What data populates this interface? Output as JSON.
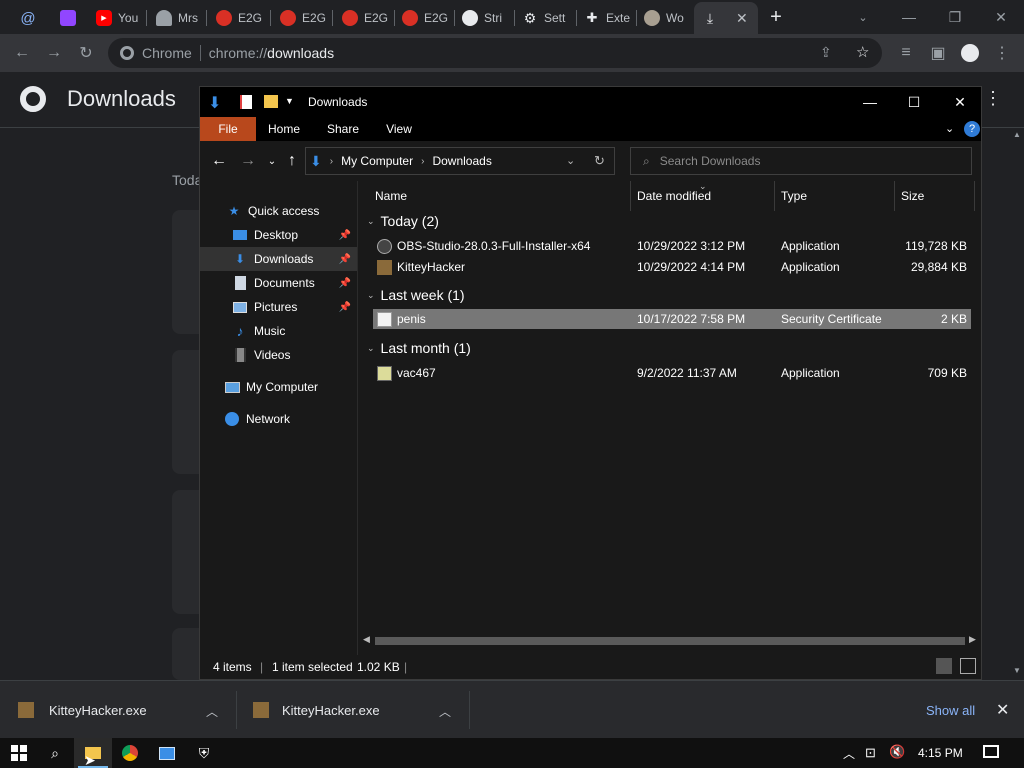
{
  "browser": {
    "tabs": [
      {
        "label": "",
        "icon": "at-sign-icon"
      },
      {
        "label": "",
        "icon": "twitch-icon"
      },
      {
        "label": "You",
        "icon": "youtube-icon"
      },
      {
        "label": "Mrs",
        "icon": "hat-icon"
      },
      {
        "label": "E2G",
        "icon": "e2g-icon"
      },
      {
        "label": "E2G",
        "icon": "e2g-icon"
      },
      {
        "label": "E2G",
        "icon": "e2g-icon"
      },
      {
        "label": "E2G",
        "icon": "e2g-icon"
      },
      {
        "label": "Stri",
        "icon": "github-icon"
      },
      {
        "label": "Sett",
        "icon": "gear-icon"
      },
      {
        "label": "Exte",
        "icon": "puzzle-icon"
      },
      {
        "label": "Wo",
        "icon": "avatar-icon"
      },
      {
        "label": "",
        "icon": "download-icon"
      }
    ],
    "omnibox": {
      "site": "Chrome",
      "url_scheme": "chrome://",
      "url_path": "downloads"
    },
    "page_title": "Downloads",
    "section_label": "Toda"
  },
  "explorer": {
    "title": "Downloads",
    "ribbon_tabs": [
      "File",
      "Home",
      "Share",
      "View"
    ],
    "breadcrumb": [
      "My Computer",
      "Downloads"
    ],
    "search_placeholder": "Search Downloads",
    "nav": {
      "quick_access": "Quick access",
      "items": [
        "Desktop",
        "Downloads",
        "Documents",
        "Pictures",
        "Music",
        "Videos"
      ],
      "my_computer": "My Computer",
      "network": "Network"
    },
    "columns": {
      "name": "Name",
      "date": "Date modified",
      "type": "Type",
      "size": "Size"
    },
    "groups": {
      "today": "Today (2)",
      "last_week": "Last week (1)",
      "last_month": "Last month (1)"
    },
    "files": [
      {
        "name": "OBS-Studio-28.0.3-Full-Installer-x64",
        "date": "10/29/2022 3:12 PM",
        "type": "Application",
        "size": "119,728 KB"
      },
      {
        "name": "KitteyHacker",
        "date": "10/29/2022 4:14 PM",
        "type": "Application",
        "size": "29,884 KB"
      },
      {
        "name": "penis",
        "date": "10/17/2022 7:58 PM",
        "type": "Security Certificate",
        "size": "2 KB"
      },
      {
        "name": "vac467",
        "date": "9/2/2022 11:37 AM",
        "type": "Application",
        "size": "709 KB"
      }
    ],
    "status": {
      "items": "4 items",
      "selected": "1 item selected",
      "size": "1.02 KB"
    }
  },
  "shelf": {
    "items": [
      "KitteyHacker.exe",
      "KitteyHacker.exe"
    ],
    "show_all": "Show all"
  },
  "taskbar": {
    "clock": "4:15 PM"
  },
  "colors": {
    "accent_file_tab": "#b8481c",
    "link": "#8ab4f8",
    "selection": "#777777"
  }
}
